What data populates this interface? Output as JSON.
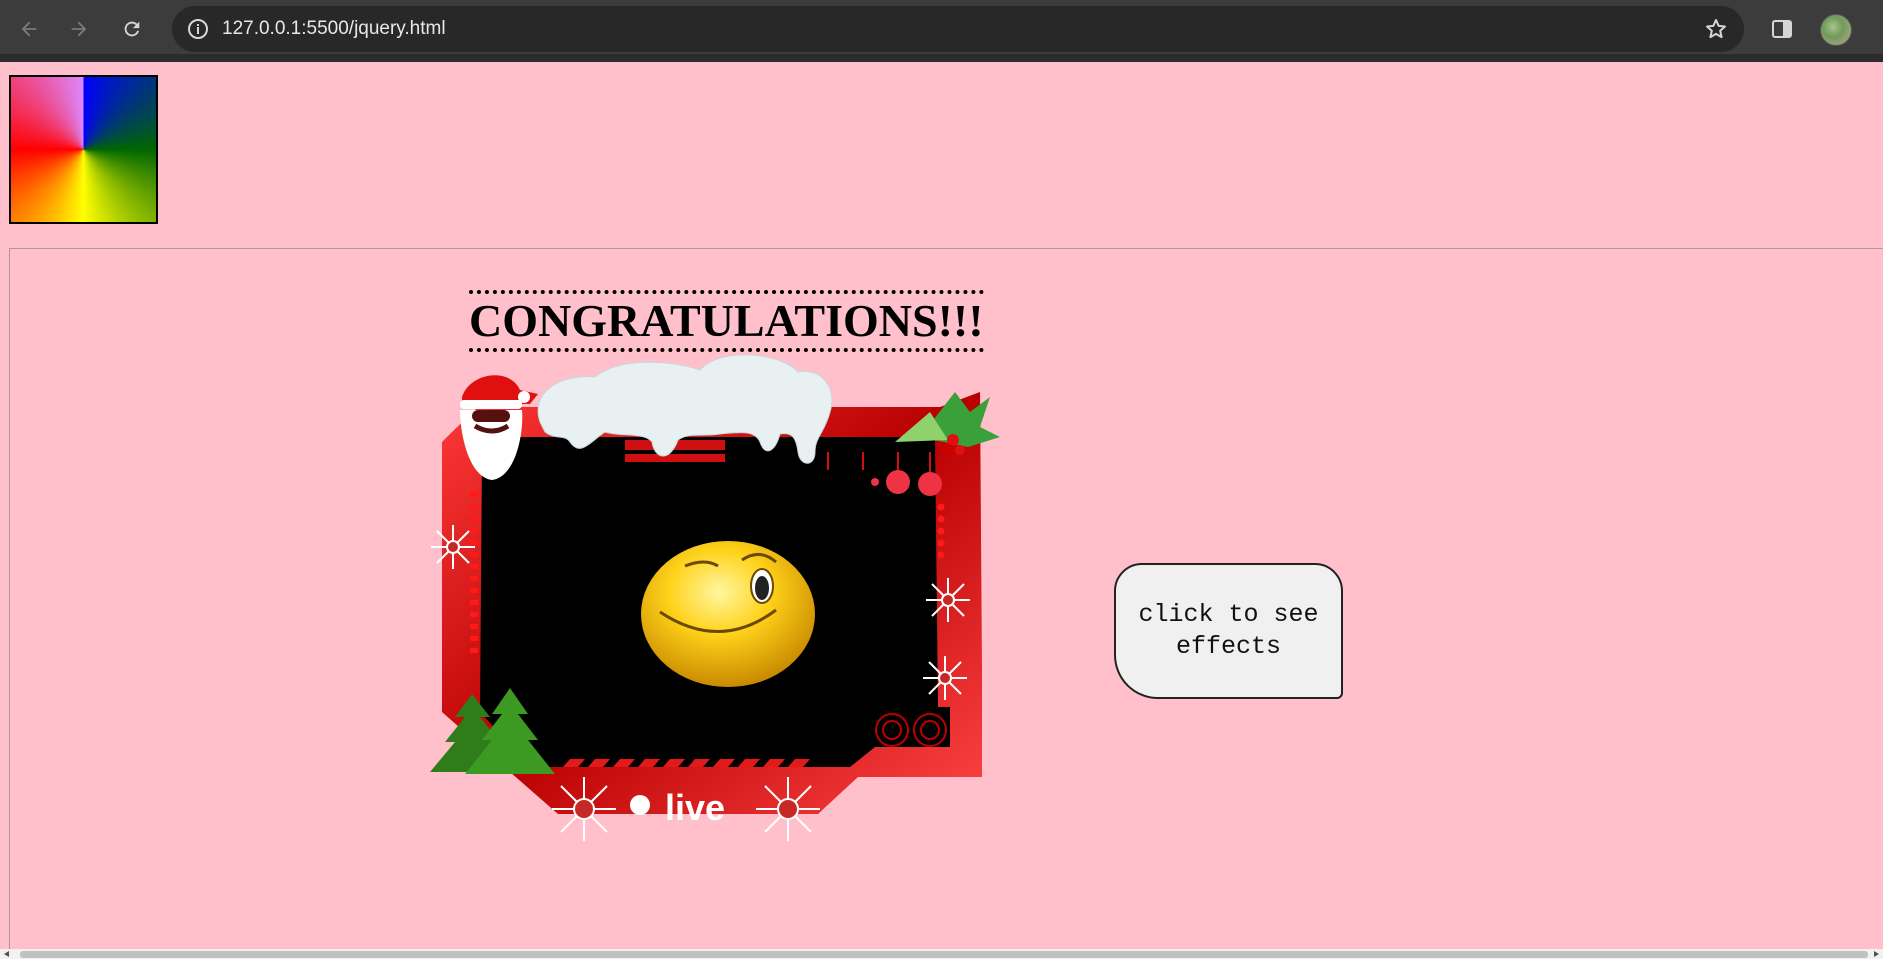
{
  "browser": {
    "url": "127.0.0.1:5500/jquery.html",
    "back_icon": "arrow-left-icon",
    "forward_icon": "arrow-right-icon",
    "reload_icon": "reload-icon",
    "info_icon": "info-icon",
    "bookmark_icon": "star-icon",
    "side_panel_icon": "side-panel-icon",
    "profile_icon": "avatar"
  },
  "page": {
    "background": "#ffc0cb",
    "heading": "CONGRATULATIONS!!!",
    "frame": {
      "badge_text": "live",
      "emoji": "winking-smiley"
    },
    "effects_button": "click to see effects"
  }
}
